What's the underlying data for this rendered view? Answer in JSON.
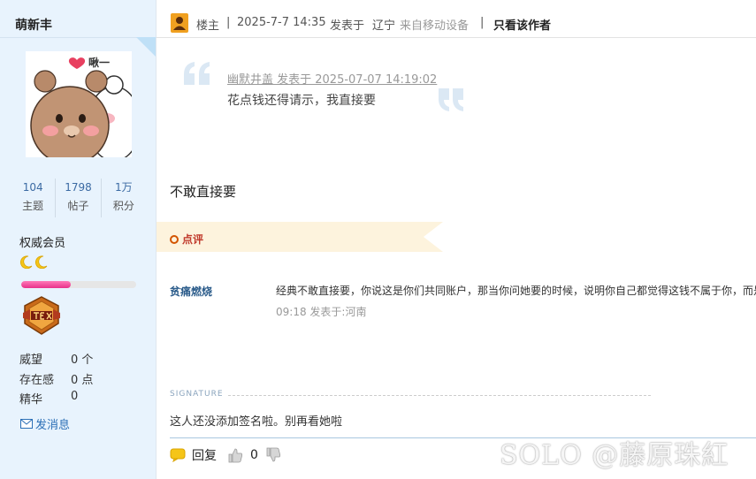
{
  "profile": {
    "username": "萌新丰",
    "avatar_caption": "啾一",
    "stats": [
      {
        "value": "104",
        "label": "主题"
      },
      {
        "value": "1798",
        "label": "帖子"
      },
      {
        "value": "1万",
        "label": "积分"
      }
    ],
    "group": "权威会员",
    "level_progress": 0.43,
    "attributes": [
      {
        "key": "威望",
        "value": "0 个"
      },
      {
        "key": "存在感",
        "value": "0 点"
      },
      {
        "key": "精华",
        "value": "0"
      }
    ],
    "send_message": "发消息"
  },
  "post_header": {
    "role": "楼主",
    "datetime": "2025-7-7 14:35",
    "posted_in_label": "发表于",
    "location": "辽宁",
    "device": "来自移动设备",
    "only_author": "只看该作者"
  },
  "quote": {
    "meta": "幽默井盖 发表于 2025-07-07 14:19:02",
    "text": "花点钱还得请示，我直接要"
  },
  "post_body": "不敢直接要",
  "rating_label": "点评",
  "comment": {
    "user": "贫痛燃烧",
    "text": "经典不敢直接要，你说这是你们共同账户，那当你问她要的时候，说明你自己都觉得这钱不属于你，而是",
    "time": "09:18 发表于:河南"
  },
  "signature": {
    "label": "SIGNATURE",
    "text": "这人还没添加签名啦。别再看她啦"
  },
  "footer": {
    "reply": "回复",
    "likes": "0"
  },
  "watermark": "SOLO @藤原珠紅",
  "colors": {
    "sidebar_bg": "#e8f3fd",
    "link_blue": "#3b6aa3",
    "accent_orange": "#f0a020",
    "progress_pink": "#e8328a"
  }
}
